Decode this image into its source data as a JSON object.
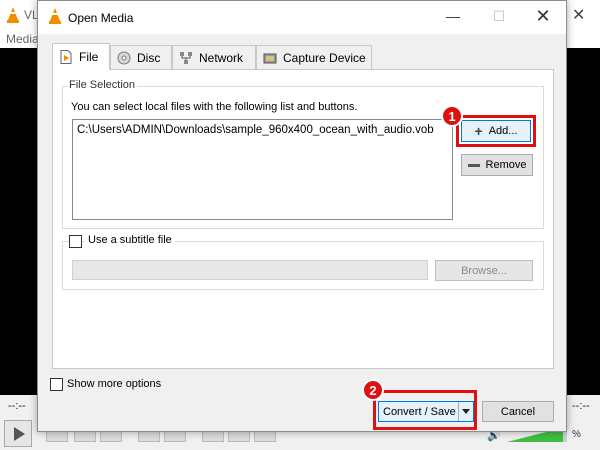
{
  "vlc": {
    "title": "VL",
    "menu_media": "Media",
    "time_left": "--:--",
    "time_right": "--:--",
    "volume_pct": "%"
  },
  "dialog": {
    "title": "Open Media",
    "minimize": "—",
    "maximize": "☐",
    "close": "✕"
  },
  "tabs": [
    {
      "label": "File",
      "icon": "file-icon",
      "active": true
    },
    {
      "label": "Disc",
      "icon": "disc-icon",
      "active": false
    },
    {
      "label": "Network",
      "icon": "network-icon",
      "active": false
    },
    {
      "label": "Capture Device",
      "icon": "capture-device-icon",
      "active": false
    }
  ],
  "file_selection": {
    "group_title": "File Selection",
    "description": "You can select local files with the following list and buttons.",
    "files": [
      "C:\\Users\\ADMIN\\Downloads\\sample_960x400_ocean_with_audio.vob"
    ],
    "add_label": "Add...",
    "remove_label": "Remove"
  },
  "subtitle": {
    "checkbox_label": "Use a subtitle file",
    "checked": false,
    "path_value": "",
    "browse_label": "Browse..."
  },
  "footer": {
    "show_more_label": "Show more options",
    "convert_label": "Convert / Save",
    "cancel_label": "Cancel"
  },
  "annotations": {
    "badge_1": "1",
    "badge_2": "2",
    "highlight_color": "#dd1111"
  },
  "colors": {
    "accent": "#0078d7",
    "vlc_orange": "#f28c00"
  }
}
